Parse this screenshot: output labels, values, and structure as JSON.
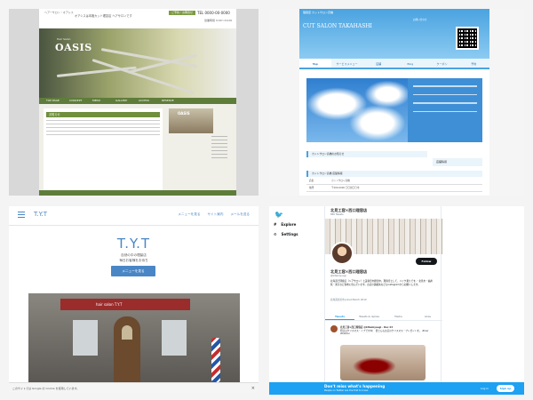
{
  "oasis": {
    "top_small": "ヘアーサロン・オアシス",
    "top_desc": "オアシスは本格カット理容店 ヘアサロンです",
    "top_button": "ご予約・お問合せ",
    "tel": "TEL 0000-00-0000",
    "tel_sub": "営業時間 9:00〜19:00",
    "logo_sub": "Hair Salon",
    "logo": "OASIS",
    "nav": [
      "TOP PAGE",
      "CONCEPT",
      "MENU",
      "GALLERY",
      "ACCESS",
      "RESERVE"
    ],
    "main_title": "お知らせ",
    "shop_sign": "OASIS"
  },
  "takahashi": {
    "small": "理容室 カットサロン高橋",
    "title": "CUT SALON TAKAHASHI",
    "info": "お問い合わせ",
    "nav": [
      "Top",
      "サービスメニュー",
      "店舗",
      "Blog",
      "クーポン",
      "予約"
    ],
    "strip1": "カットサロン高橋のお知らせ",
    "strip2": "カットサロン高橋 店舗情報",
    "side": "店舗情報",
    "table": [
      {
        "k": "店名",
        "v": "カットサロン高橋"
      },
      {
        "k": "住所",
        "v": "〒000-0000 〇〇県〇〇市"
      },
      {
        "k": "電話",
        "v": "000-000-0000"
      }
    ]
  },
  "tyt": {
    "brand": "T.Y.T",
    "links": [
      "メニューを見る",
      "サイト案内",
      "メールを送る"
    ],
    "title": "T.Y.T",
    "sub1": "自然の中の理髪店",
    "sub2": "毎日お客様をお待ち",
    "button": "メニューを見る",
    "awning": "hair salon T.Y.T",
    "cookie": "このサイトでは Google の Cookie を使用しています。",
    "close": "×"
  },
  "twitter": {
    "nav": [
      {
        "icon": "#",
        "label": "Explore"
      },
      {
        "icon": "⚙",
        "label": "Settings"
      }
    ],
    "header_name": "北見工容×西口理容店",
    "header_count": "856 Tweets",
    "follow": "Follow",
    "profile_name": "北見工容×西口理容店",
    "handle": "@kitamiyougi",
    "bio": "北海道で理容店（ヘアサロン）と美容室を経営中。理容室として、バイク乗りです。・北見市・福井県・東京など各地に住んでいます。お店の連絡先などもInstagramからお願いします。",
    "meta": "北海道北見市   Joined March 2019",
    "tabs": [
      "Tweets",
      "Tweets & replies",
      "Media",
      "Likes"
    ],
    "tweet_head": "北見工容×西口理容店 @kitamiyougi · Dec 23",
    "tweet_body": "明日はクリスマス・イブですね！ 皆さんもお店のクリスマス・プレゼントを。 #hair #barber",
    "banner_title": "Don't miss what's happening",
    "banner_sub": "People on Twitter are the first to know.",
    "login": "Log in",
    "signup": "Sign up"
  }
}
